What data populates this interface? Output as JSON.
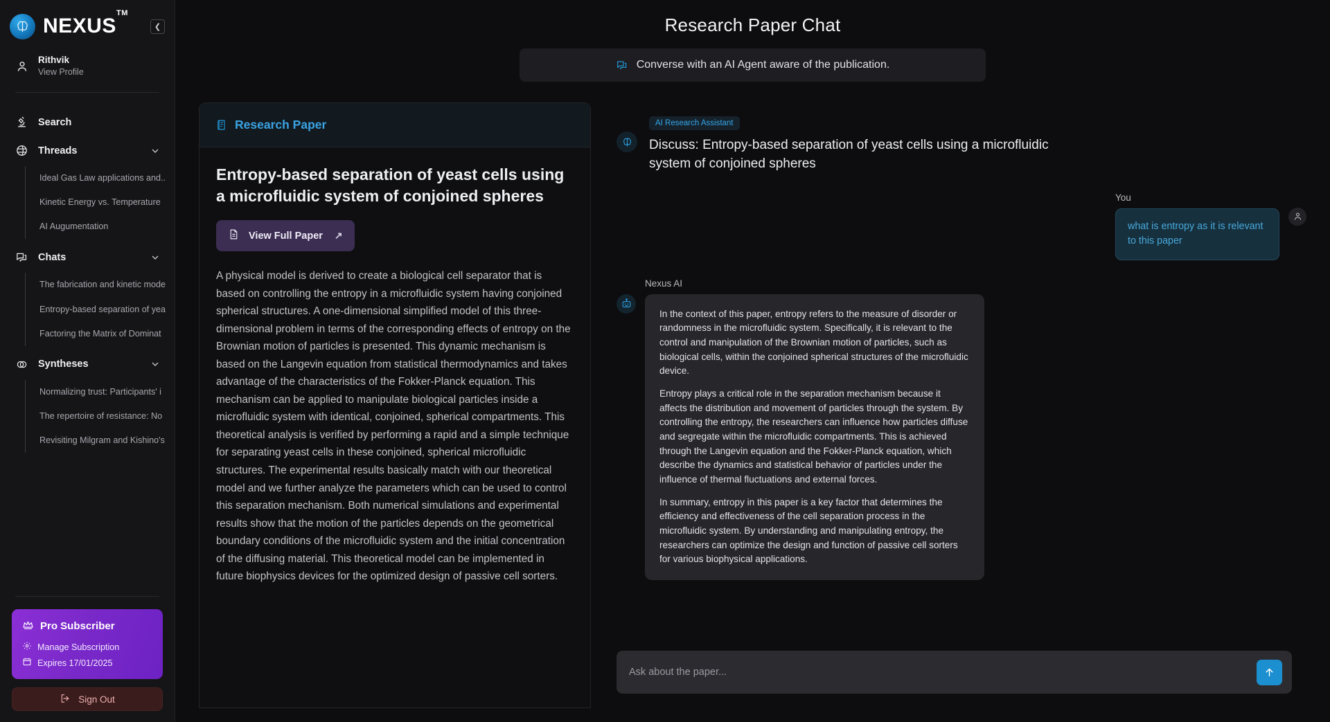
{
  "brand": {
    "name": "NEXUS",
    "tm": "TM",
    "logo_icon": "brain-icon",
    "collapse_icon": "chevron-left-icon"
  },
  "profile": {
    "name": "Rithvik",
    "link": "View Profile",
    "icon": "user-icon"
  },
  "sidebar": {
    "search": {
      "label": "Search",
      "icon": "microscope-icon"
    },
    "groups": [
      {
        "label": "Threads",
        "icon": "globe-icon",
        "chevron": "chevron-down-icon",
        "items": [
          "Ideal Gas Law applications and..",
          "Kinetic Energy vs. Temperature",
          "AI Augumentation"
        ]
      },
      {
        "label": "Chats",
        "icon": "chats-icon",
        "chevron": "chevron-down-icon",
        "items": [
          "The fabrication and kinetic mode",
          "Entropy-based separation of yea",
          "Factoring the Matrix of Dominat"
        ]
      },
      {
        "label": "Syntheses",
        "icon": "syntheses-icon",
        "chevron": "chevron-down-icon",
        "items": [
          "Normalizing trust: Participants' i",
          "The repertoire of resistance: No",
          "Revisiting Milgram and Kishino's"
        ]
      }
    ],
    "subscription": {
      "title": "Pro Subscriber",
      "crown_icon": "crown-icon",
      "manage": "Manage Subscription",
      "manage_icon": "gear-icon",
      "expires": "Expires 17/01/2025",
      "expires_icon": "calendar-icon"
    },
    "sign_out": {
      "label": "Sign Out",
      "icon": "sign-out-icon"
    }
  },
  "header": {
    "title": "Research Paper Chat",
    "subtitle": "Converse with an AI Agent aware of the publication.",
    "subtitle_icon": "chats-icon"
  },
  "paper": {
    "panel_label": "Research Paper",
    "panel_icon": "document-icon",
    "title": "Entropy-based separation of yeast cells using a microfluidic system of conjoined spheres",
    "view_button": "View Full Paper",
    "view_button_icon": "file-icon",
    "view_button_arrow": "arrow-up-right-icon",
    "abstract": "A physical model is derived to create a biological cell separator that is based on controlling the entropy in a microfluidic system having conjoined spherical structures. A one-dimensional simplified model of this three-dimensional problem in terms of the corresponding effects of entropy on the Brownian motion of particles is presented. This dynamic mechanism is based on the Langevin equation from statistical thermodynamics and takes advantage of the characteristics of the Fokker-Planck equation. This mechanism can be applied to manipulate biological particles inside a microfluidic system with identical, conjoined, spherical compartments. This theoretical analysis is verified by performing a rapid and a simple technique for separating yeast cells in these conjoined, spherical microfluidic structures. The experimental results basically match with our theoretical model and we further analyze the parameters which can be used to control this separation mechanism. Both numerical simulations and experimental results show that the motion of the particles depends on the geometrical boundary conditions of the microfluidic system and the initial concentration of the diffusing material. This theoretical model can be implemented in future biophysics devices for the optimized design of passive cell sorters."
  },
  "chat": {
    "badge": "AI Research Assistant",
    "topic": "Discuss: Entropy-based separation of yeast cells using a microfluidic system of conjoined spheres",
    "topic_icon": "brain-icon",
    "user": {
      "label": "You",
      "avatar_icon": "user-icon",
      "message": "what is entropy as it is relevant to this paper"
    },
    "assistant": {
      "label": "Nexus AI",
      "avatar_icon": "robot-icon",
      "paragraphs": [
        "In the context of this paper, entropy refers to the measure of disorder or randomness in the microfluidic system. Specifically, it is relevant to the control and manipulation of the Brownian motion of particles, such as biological cells, within the conjoined spherical structures of the microfluidic device.",
        "Entropy plays a critical role in the separation mechanism because it affects the distribution and movement of particles through the system. By controlling the entropy, the researchers can influence how particles diffuse and segregate within the microfluidic compartments. This is achieved through the Langevin equation and the Fokker-Planck equation, which describe the dynamics and statistical behavior of particles under the influence of thermal fluctuations and external forces.",
        "In summary, entropy in this paper is a key factor that determines the efficiency and effectiveness of the cell separation process in the microfluidic system. By understanding and manipulating entropy, the researchers can optimize the design and function of passive cell sorters for various biophysical applications."
      ]
    },
    "composer": {
      "placeholder": "Ask about the paper...",
      "send_icon": "arrow-up-icon",
      "value": ""
    }
  },
  "colors": {
    "accent_blue": "#2196d8",
    "pro_purple": "#8b2fd6",
    "sign_out_red": "#3a1c1c",
    "user_bubble": "#16303d"
  }
}
